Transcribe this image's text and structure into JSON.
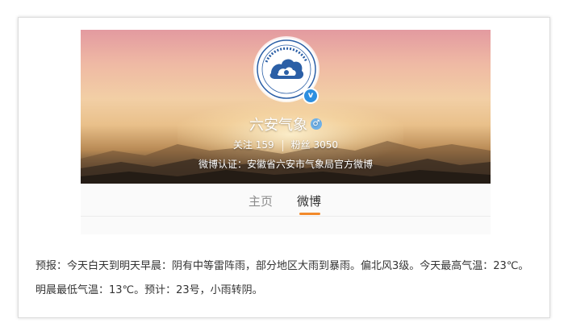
{
  "profile": {
    "name": "六安气象",
    "gender_symbol": "♂",
    "verified_mark": "v",
    "follow_label": "关注",
    "follow_count": "159",
    "fans_label": "粉丝",
    "fans_count": "3050",
    "verification_text": "微博认证：安徽省六安市气象局官方微博",
    "avatar_icon": "cloud-emblem-icon"
  },
  "tabs": [
    {
      "label": "主页",
      "active": false
    },
    {
      "label": "微博",
      "active": true
    }
  ],
  "colors": {
    "accent": "#f28a2b",
    "verified": "#2d8fe0",
    "emblem_blue": "#2b5fa6"
  },
  "forecast": {
    "text": "预报：今天白天到明天早晨：阴有中等雷阵雨，部分地区大雨到暴雨。偏北风3级。今天最高气温：23℃。明晨最低气温：13℃。预计：23号，小雨转阴。"
  }
}
